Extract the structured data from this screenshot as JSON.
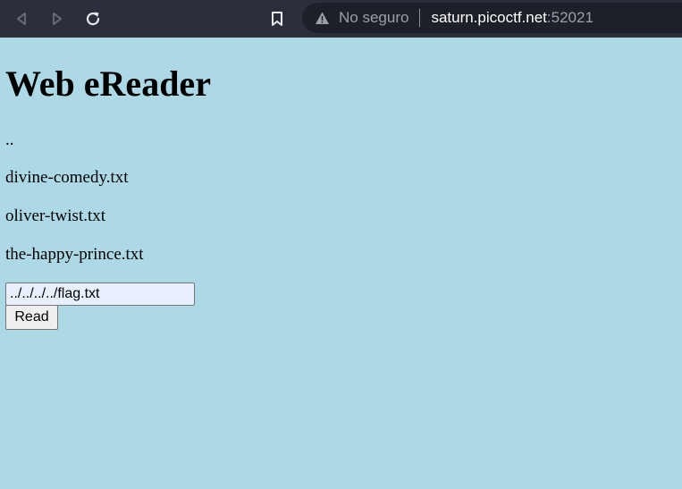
{
  "browser": {
    "security_label": "No seguro",
    "url_host": "saturn.picoctf.net",
    "url_port": ":52021"
  },
  "page": {
    "title": "Web eReader",
    "links": [
      "..",
      "divine-comedy.txt",
      "oliver-twist.txt",
      "the-happy-prince.txt"
    ],
    "input_value": "../../../../flag.txt",
    "read_button_label": "Read"
  }
}
